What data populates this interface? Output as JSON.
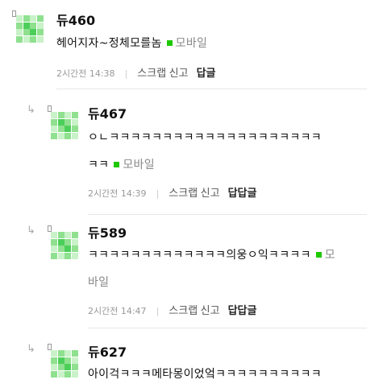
{
  "comments": [
    {
      "nickname": "듀460",
      "text": "헤어지자~정체모를놈",
      "device": "모바일",
      "time": "2시간전 14:38",
      "scrap": "스크랩",
      "report": "신고",
      "reply": "답글"
    },
    {
      "nickname": "듀467",
      "text_line1": "ㅇㄴㅋㅋㅋㅋㅋㅋㅋㅋㅋㅋㅋㅋㅋㅋㅋㅋㅋㅋㅋㅋ",
      "text_line2": "ㅋㅋ",
      "device": "모바일",
      "time": "2시간전 14:39",
      "scrap": "스크랩",
      "report": "신고",
      "reply": "답답글"
    },
    {
      "nickname": "듀589",
      "text_line1": "ㅋㅋㅋㅋㅋㅋㅋㅋㅋㅋㅋㅋㅋ의웅ㅇ익ㅋㅋㅋㅋ",
      "device_part1": "모",
      "device_part2": "바일",
      "time": "2시간전 14:47",
      "scrap": "스크랩",
      "report": "신고",
      "reply": "답답글"
    },
    {
      "nickname": "듀627",
      "text_line1": "아이걱ㅋㅋㅋ메타몽이었엌ㅋㅋㅋㅋㅋㅋㅋㅋㅋㅋ"
    }
  ],
  "colors": {
    "mobile_dot": "#1ec800",
    "avatar_light": "#c9f2c9",
    "avatar_mid": "#8fe08f",
    "avatar_dark": "#4ccf5a"
  },
  "icons": {
    "reply_arrow": "↳",
    "level_badge": "level-badge-icon",
    "avatar": "pixel-avatar-icon"
  }
}
